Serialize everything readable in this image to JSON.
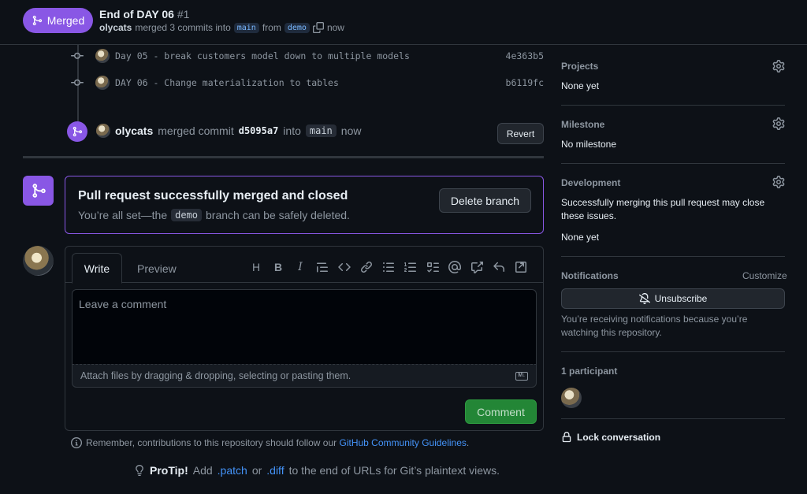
{
  "header": {
    "status_badge": "Merged",
    "title": "End of DAY 06",
    "number": "#1",
    "author": "olycats",
    "merged_text": "merged 3 commits into",
    "base_branch": "main",
    "from_text": "from",
    "head_branch": "demo",
    "time": "now"
  },
  "timeline": {
    "commits": [
      {
        "message": "Day 05 - break customers model down to multiple models",
        "sha": "4e363b5"
      },
      {
        "message": "DAY 06 - Change materialization to tables",
        "sha": "b6119fc"
      }
    ],
    "merge_event": {
      "author": "olycats",
      "text": "merged commit",
      "sha": "d5095a7",
      "into_text": "into",
      "branch": "main",
      "time": "now",
      "revert_label": "Revert"
    }
  },
  "merged_box": {
    "title": "Pull request successfully merged and closed",
    "sub_before": "You’re all set—the",
    "branch": "demo",
    "sub_after": "branch can be safely deleted.",
    "delete_label": "Delete branch"
  },
  "comment": {
    "tab_write": "Write",
    "tab_preview": "Preview",
    "placeholder": "Leave a comment",
    "attach_text": "Attach files by dragging & dropping, selecting or pasting them.",
    "submit_label": "Comment",
    "remember_text": "Remember, contributions to this repository should follow our",
    "guidelines_link": "GitHub Community Guidelines",
    "remember_end": "."
  },
  "protip": {
    "label": "ProTip!",
    "text1": "Add",
    "patch": ".patch",
    "or": "or",
    "diff": ".diff",
    "text2": "to the end of URLs for Git’s plaintext views."
  },
  "sidebar": {
    "projects": {
      "title": "Projects",
      "value": "None yet"
    },
    "milestone": {
      "title": "Milestone",
      "value": "No milestone"
    },
    "development": {
      "title": "Development",
      "value": "Successfully merging this pull request may close these issues.",
      "value2": "None yet"
    },
    "notifications": {
      "title": "Notifications",
      "customize": "Customize",
      "unsubscribe": "Unsubscribe",
      "note": "You’re receiving notifications because you’re watching this repository."
    },
    "participants": {
      "title": "1 participant"
    },
    "lock": "Lock conversation"
  }
}
